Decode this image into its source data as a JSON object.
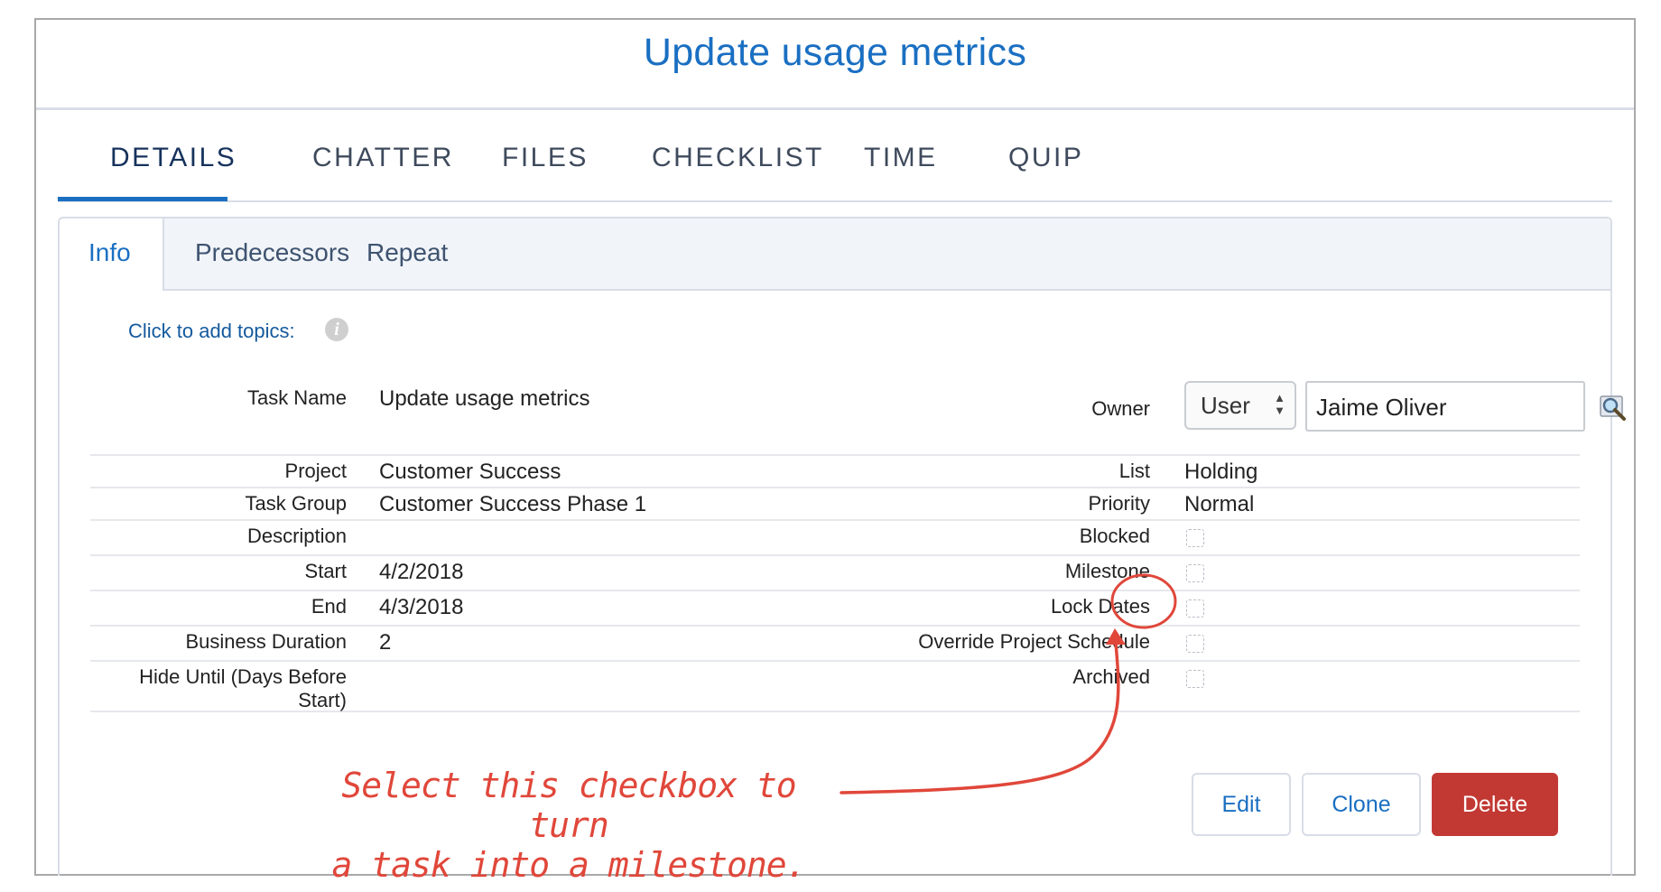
{
  "header": {
    "title": "Update usage metrics"
  },
  "tabs": [
    {
      "label": "DETAILS",
      "active": true
    },
    {
      "label": "CHATTER"
    },
    {
      "label": "FILES"
    },
    {
      "label": "CHECKLIST"
    },
    {
      "label": "TIME"
    },
    {
      "label": "QUIP"
    }
  ],
  "subtabs": [
    {
      "label": "Info",
      "active": true
    },
    {
      "label": "Predecessors"
    },
    {
      "label": "Repeat"
    }
  ],
  "topics": {
    "label": "Click to add topics:",
    "icon": "info-icon"
  },
  "fields": {
    "task_name": {
      "label": "Task Name",
      "value": "Update usage metrics"
    },
    "owner": {
      "label": "Owner",
      "type_value": "User",
      "value": "Jaime Oliver",
      "lookup_icon": "lookup-magnifier-icon"
    },
    "project": {
      "label": "Project",
      "value": "Customer Success"
    },
    "list": {
      "label": "List",
      "value": "Holding"
    },
    "task_group": {
      "label": "Task Group",
      "value": "Customer Success Phase 1"
    },
    "priority": {
      "label": "Priority",
      "value": "Normal"
    },
    "description": {
      "label": "Description",
      "value": ""
    },
    "blocked": {
      "label": "Blocked",
      "checked": false
    },
    "start": {
      "label": "Start",
      "value": "4/2/2018"
    },
    "milestone": {
      "label": "Milestone",
      "checked": false
    },
    "end": {
      "label": "End",
      "value": "4/3/2018"
    },
    "lock_dates": {
      "label": "Lock Dates",
      "checked": false
    },
    "business_duration": {
      "label": "Business Duration",
      "value": "2"
    },
    "override_schedule": {
      "label": "Override Project Schedule",
      "checked": false
    },
    "hide_until_line1": "Hide Until (Days Before",
    "hide_until_line2": "Start)",
    "archived": {
      "label": "Archived",
      "checked": false
    }
  },
  "buttons": {
    "edit": "Edit",
    "clone": "Clone",
    "delete": "Delete"
  },
  "annotation": {
    "line1": "Select this checkbox to turn",
    "line2": "a task into a milestone."
  },
  "colors": {
    "brand_blue": "#1a6fc2",
    "danger_red": "#c23934",
    "annotation_red": "#e0473a",
    "border": "#d8dde6"
  }
}
